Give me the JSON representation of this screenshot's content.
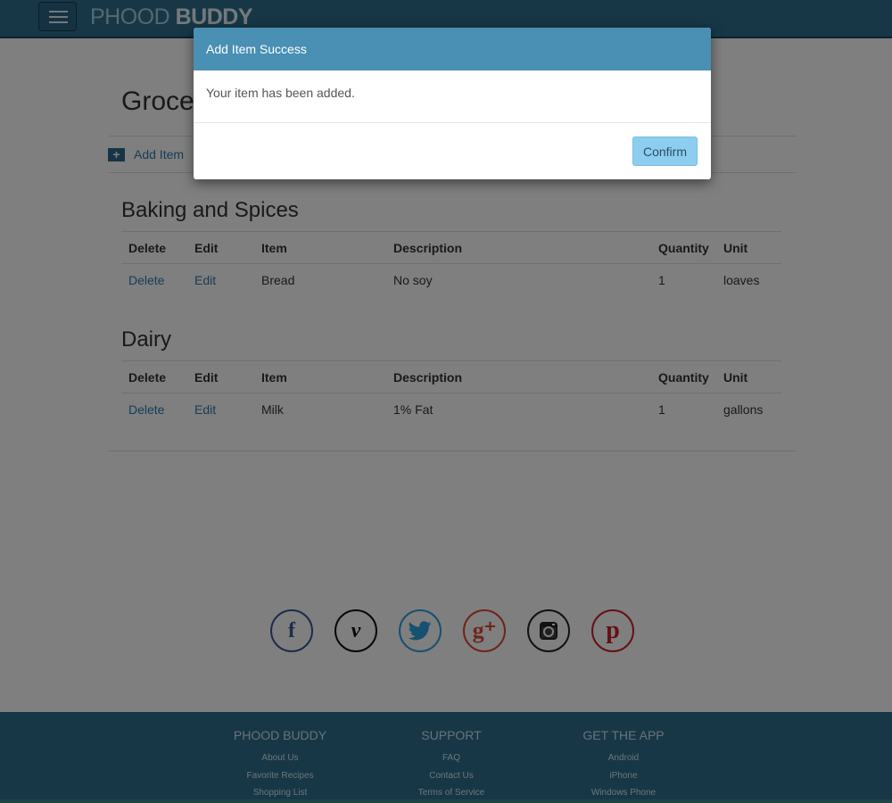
{
  "navbar": {
    "brand_light": "PHOOD ",
    "brand_bold": "BUDDY"
  },
  "page": {
    "title": "Grocery List",
    "add_item_label": "Add Item"
  },
  "table_headers": [
    "Delete",
    "Edit",
    "Item",
    "Description",
    "Quantity",
    "Unit"
  ],
  "sections": [
    {
      "title": "Baking and Spices",
      "rows": [
        {
          "delete": "Delete",
          "edit": "Edit",
          "item": "Bread",
          "description": "No soy",
          "quantity": "1",
          "unit": "loaves"
        }
      ]
    },
    {
      "title": "Dairy",
      "rows": [
        {
          "delete": "Delete",
          "edit": "Edit",
          "item": "Milk",
          "description": "1% Fat",
          "quantity": "1",
          "unit": "gallons"
        }
      ]
    }
  ],
  "social": [
    {
      "icon": "facebook-icon",
      "glyph": "f"
    },
    {
      "icon": "vimeo-icon",
      "glyph": "v"
    },
    {
      "icon": "twitter-icon",
      "glyph": "🐦"
    },
    {
      "icon": "google-plus-icon",
      "glyph": "g⁺"
    },
    {
      "icon": "instagram-icon",
      "glyph": "◙"
    },
    {
      "icon": "pinterest-icon",
      "glyph": "p"
    }
  ],
  "footer": {
    "columns": [
      {
        "heading": "PHOOD BUDDY",
        "links": [
          "About Us",
          "Favorite Recipes",
          "Shopping List"
        ]
      },
      {
        "heading": "SUPPORT",
        "links": [
          "FAQ",
          "Contact Us",
          "Terms of Service"
        ]
      },
      {
        "heading": "GET THE APP",
        "links": [
          "Android",
          "iPhone",
          "Windows Phone"
        ]
      }
    ]
  },
  "modal": {
    "title": "Add Item Success",
    "message": "Your item has been added.",
    "confirm_label": "Confirm"
  },
  "colors": {
    "navbar": "#2e6e8e",
    "modal_header": "#4a8fb4",
    "confirm_button": "#8dcdef",
    "link": "#2d7bb0"
  }
}
